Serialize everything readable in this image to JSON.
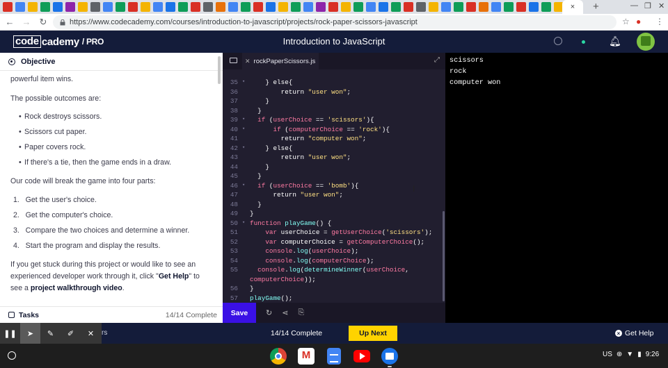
{
  "browser": {
    "url": "https://www.codecademy.com/courses/introduction-to-javascript/projects/rock-paper-scissors-javascript",
    "active_tab_close": "×",
    "new_tab": "+"
  },
  "header": {
    "logo_code": "code",
    "logo_rest": "cademy",
    "logo_pro": "/ PRO",
    "title": "Introduction to JavaScript"
  },
  "lesson": {
    "section_title": "Objective",
    "lines": [
      "powerful item wins.",
      "The possible outcomes are:"
    ],
    "outcomes": [
      "Rock destroys scissors.",
      "Scissors cut paper.",
      "Paper covers rock.",
      "If there's a tie, then the game ends in a draw."
    ],
    "parts_intro": "Our code will break the game into four parts:",
    "parts": [
      "Get the user's choice.",
      "Get the computer's choice.",
      "Compare the two choices and determine a winner.",
      "Start the program and display the results."
    ],
    "stuck_1": "If you get stuck during this project or would like to see an",
    "stuck_2a": "experienced developer work through it, click \"",
    "stuck_2b": "Get Help",
    "stuck_2c": "\" to",
    "stuck_3a": "see a ",
    "stuck_3b": "project walkthrough video",
    "stuck_3c": ".",
    "tasks_label": "Tasks",
    "tasks_count": "14/14 Complete"
  },
  "editor": {
    "file_name": "rockPaperScissors.js",
    "save_label": "Save",
    "code_lines": [
      {
        "n": "35",
        "fold": "▾",
        "html": "    } else{"
      },
      {
        "n": "36",
        "fold": "",
        "html": "        return <span class=\"st\">\"user won\"</span>;"
      },
      {
        "n": "37",
        "fold": "",
        "html": "    }"
      },
      {
        "n": "38",
        "fold": "",
        "html": "  }"
      },
      {
        "n": "39",
        "fold": "▾",
        "html": "  <span class=\"kw\">if</span> (<span class=\"kw\">userChoice</span> == <span class=\"st\">'scissors'</span>){"
      },
      {
        "n": "40",
        "fold": "▾",
        "html": "      <span class=\"kw\">if</span> (<span class=\"kw\">computerChoice</span> == <span class=\"st\">'rock'</span>){"
      },
      {
        "n": "41",
        "fold": "",
        "html": "        return <span class=\"st\">\"computer won\"</span>;"
      },
      {
        "n": "42",
        "fold": "▾",
        "html": "    } else{"
      },
      {
        "n": "43",
        "fold": "",
        "html": "        return <span class=\"st\">\"user won\"</span>;"
      },
      {
        "n": "44",
        "fold": "",
        "html": "    }"
      },
      {
        "n": "45",
        "fold": "",
        "html": "  }"
      },
      {
        "n": "46",
        "fold": "▾",
        "html": "  <span class=\"kw\">if</span> (<span class=\"kw\">userChoice</span> == <span class=\"st\">'bomb'</span>){"
      },
      {
        "n": "47",
        "fold": "",
        "html": "      return <span class=\"st\">\"user won\"</span>;"
      },
      {
        "n": "48",
        "fold": "",
        "html": "  }"
      },
      {
        "n": "49",
        "fold": "",
        "html": "}"
      },
      {
        "n": "50",
        "fold": "▾",
        "html": "<span class=\"kw\">function</span> <span class=\"fn\">playGame</span>() {"
      },
      {
        "n": "51",
        "fold": "",
        "html": "    <span class=\"kw\">var</span> userChoice = <span class=\"kw\">getUserChoice</span>(<span class=\"st\">'scissors'</span>);"
      },
      {
        "n": "52",
        "fold": "",
        "html": "    <span class=\"kw\">var</span> computerChoice = <span class=\"kw\">getComputerChoice</span>();"
      },
      {
        "n": "53",
        "fold": "",
        "html": "    <span class=\"kw\">console</span>.<span class=\"fn\">log</span>(<span class=\"kw\">userChoice</span>);"
      },
      {
        "n": "54",
        "fold": "",
        "html": "    <span class=\"kw\">console</span>.<span class=\"fn\">log</span>(<span class=\"kw\">computerChoice</span>);"
      },
      {
        "n": "55",
        "fold": "",
        "html": "  <span class=\"kw\">console</span>.<span class=\"fn\">log</span>(<span class=\"fn\">determineWinner</span>(<span class=\"kw\">userChoice</span>,"
      },
      {
        "n": "",
        "fold": "",
        "html": "<span class=\"kw\">computerChoice</span>));"
      },
      {
        "n": "56",
        "fold": "",
        "html": "}"
      },
      {
        "n": "57",
        "fold": "",
        "html": "<span class=\"fn\">playGame</span>();"
      }
    ]
  },
  "output": {
    "lines": [
      "scissors",
      "rock",
      "computer won"
    ]
  },
  "bottom_bar": {
    "partial_label": "rs",
    "progress": "14/14 Complete",
    "up_next": "Up Next",
    "get_help": "Get Help"
  },
  "tray": {
    "locale": "US",
    "time": "9:26"
  },
  "colors": {
    "header_bg": "#141c3a",
    "editor_bg": "#211e2f",
    "save_button": "#3a10e5",
    "up_next_button": "#ffd300"
  }
}
